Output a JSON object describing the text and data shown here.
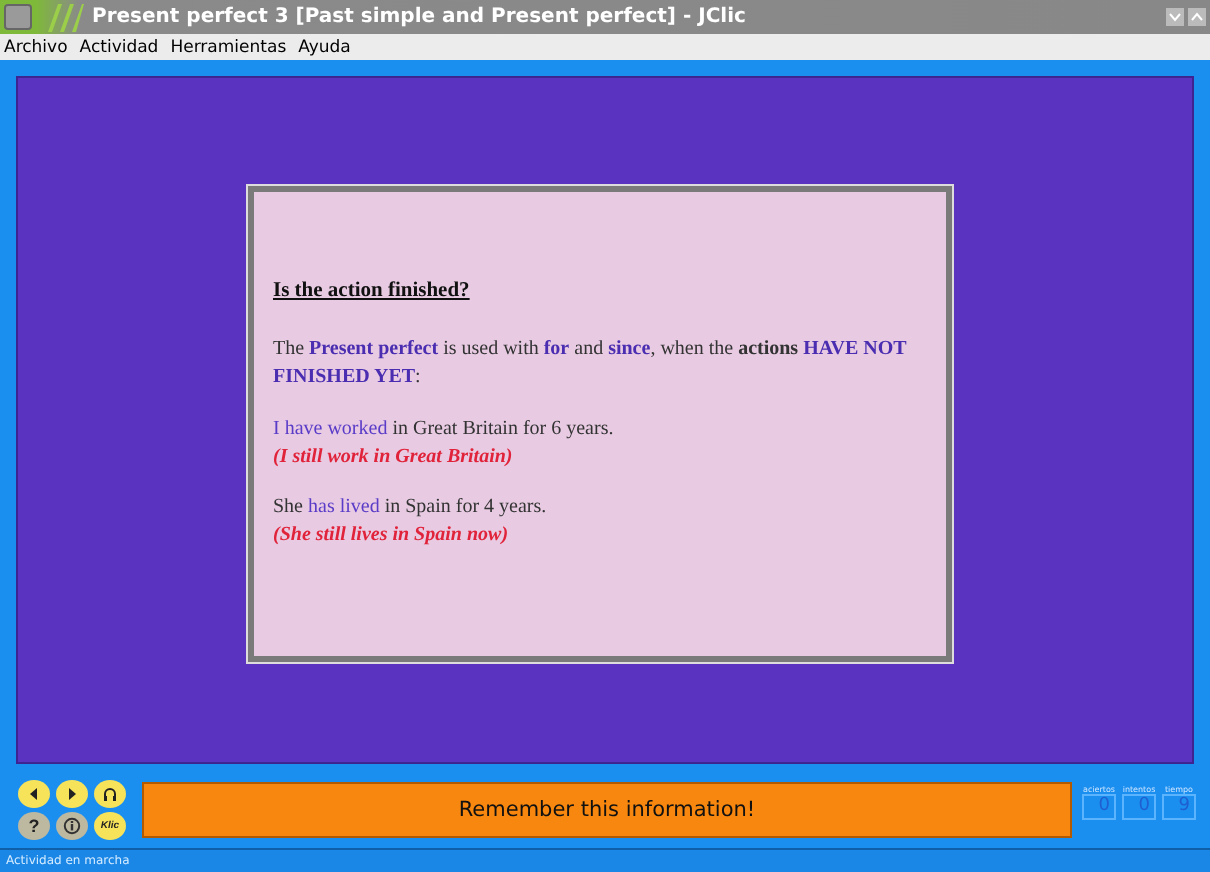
{
  "window": {
    "title": "Present perfect 3 [Past simple and Present perfect] - JClic"
  },
  "menu": [
    {
      "label": "Archivo"
    },
    {
      "label": "Actividad"
    },
    {
      "label": "Herramientas"
    },
    {
      "label": "Ayuda"
    }
  ],
  "card": {
    "heading": "Is the action finished?",
    "paragraphs": [
      {
        "runs": [
          {
            "kind": "plain",
            "text": "The "
          },
          {
            "kind": "key",
            "text": "Present perfect"
          },
          {
            "kind": "plain",
            "text": " is used with "
          },
          {
            "kind": "key",
            "text": "for"
          },
          {
            "kind": "plain",
            "text": " and "
          },
          {
            "kind": "key",
            "text": "since"
          },
          {
            "kind": "plain",
            "text": ", when the "
          },
          {
            "kind": "strong",
            "text": "actions "
          },
          {
            "kind": "key",
            "text": "HAVE NOT FINISHED YET"
          },
          {
            "kind": "plain",
            "text": ":"
          }
        ]
      },
      {
        "runs": [
          {
            "kind": "verb",
            "text": "I have worked"
          },
          {
            "kind": "plain",
            "text": " in Great Britain for 6 years."
          }
        ],
        "note": "(I still work in Great Britain)"
      },
      {
        "runs": [
          {
            "kind": "plain",
            "text": "She "
          },
          {
            "kind": "verb",
            "text": "has lived"
          },
          {
            "kind": "plain",
            "text": " in Spain for 4 years."
          }
        ],
        "note": "(She still lives in Spain now)"
      }
    ]
  },
  "controls": [
    {
      "kind": "back",
      "disabled": false
    },
    {
      "kind": "forward",
      "disabled": false
    },
    {
      "kind": "audio",
      "disabled": false
    },
    {
      "kind": "help",
      "label": "?",
      "disabled": true
    },
    {
      "kind": "info",
      "disabled": true
    },
    {
      "kind": "about",
      "label": "Klic",
      "disabled": false
    }
  ],
  "message": "Remember this information!",
  "counters": [
    {
      "label": "aciertos",
      "value": "0"
    },
    {
      "label": "intentos",
      "value": "0"
    },
    {
      "label": "tiempo",
      "value": "9"
    }
  ],
  "status_bar": "Actividad en marcha"
}
